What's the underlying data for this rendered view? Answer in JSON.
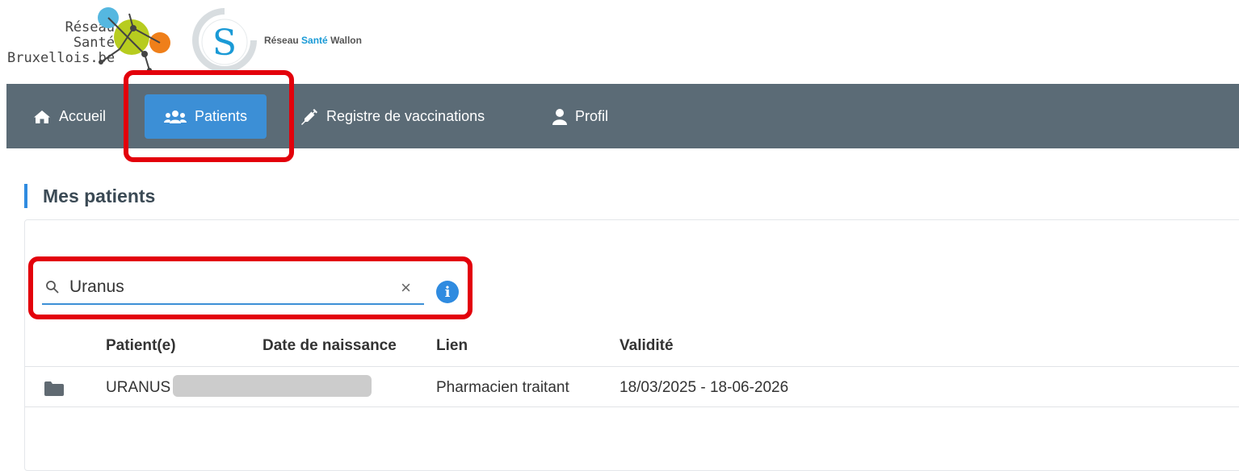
{
  "logos": {
    "rsb_lines": [
      "Réseau",
      "Santé",
      "Bruxellois.be"
    ],
    "rsw_letter": "S",
    "rsw_prefix": "Réseau",
    "rsw_accent": "Santé",
    "rsw_suffix": "Wallon"
  },
  "nav": {
    "items": [
      {
        "label": "Accueil",
        "icon": "home-icon"
      },
      {
        "label": "Patients",
        "icon": "users-icon",
        "active": true
      },
      {
        "label": "Registre de vaccinations",
        "icon": "syringe-icon"
      },
      {
        "label": "Profil",
        "icon": "user-icon"
      }
    ]
  },
  "page": {
    "title": "Mes patients"
  },
  "search": {
    "value": "Uranus",
    "clear_glyph": "×",
    "info_glyph": "i"
  },
  "table": {
    "headers": [
      "Patient(e)",
      "Date de naissance",
      "Lien",
      "Validité"
    ],
    "rows": [
      {
        "patient": "URANUS",
        "birthdate": "",
        "lien": "Pharmacien traitant",
        "validite": "18/03/2025 - 18-06-2026"
      }
    ]
  },
  "colors": {
    "navbar": "#5b6b76",
    "active_tab": "#3c8fd6",
    "highlight": "#e3000b",
    "accent": "#2f8be0"
  }
}
